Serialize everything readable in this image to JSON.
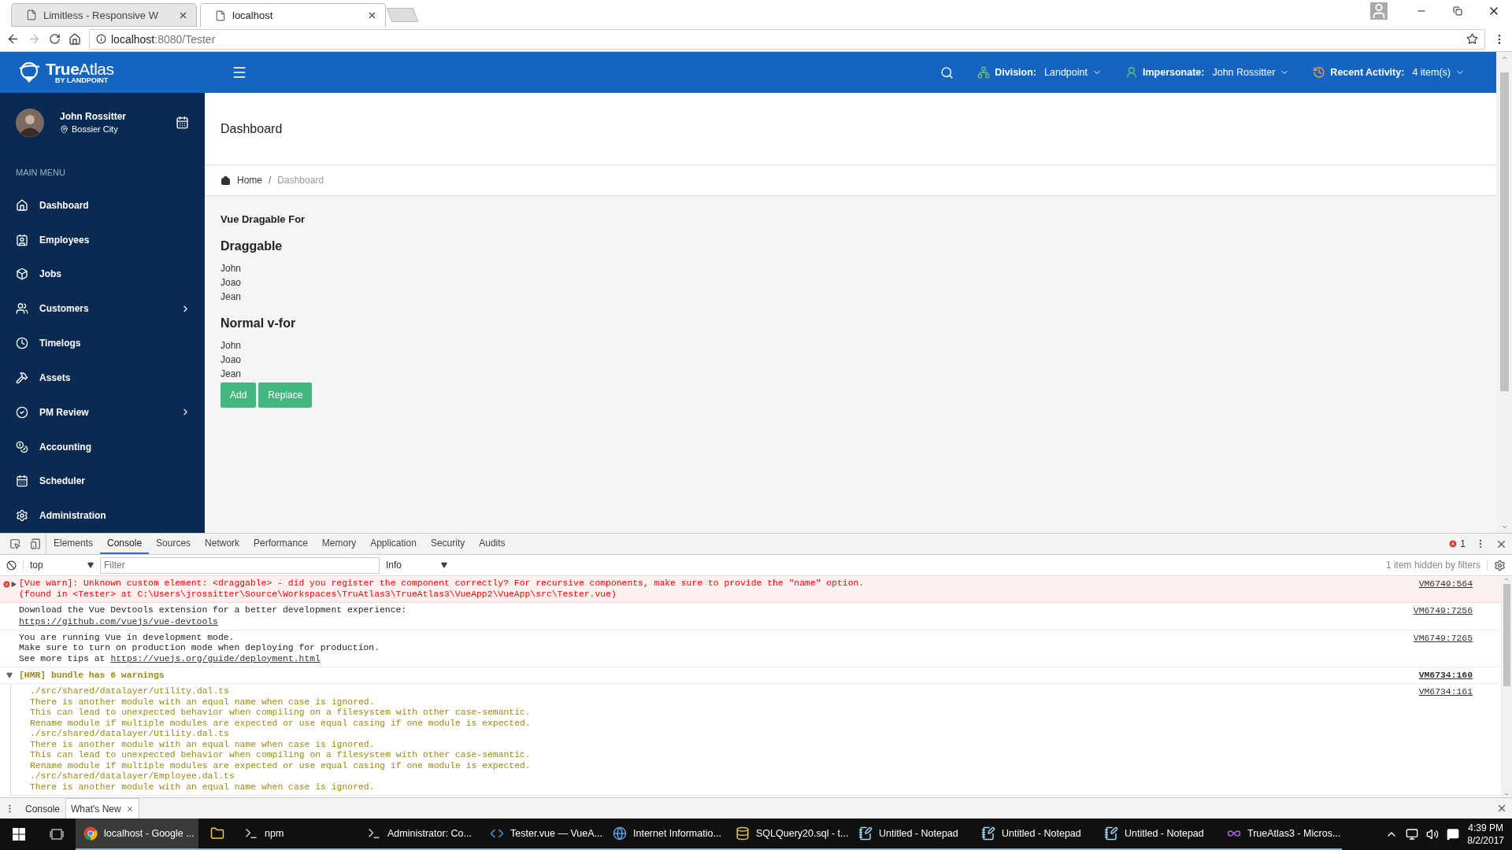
{
  "browser": {
    "tabs": [
      {
        "title": "Limitless - Responsive W",
        "selected": false
      },
      {
        "title": "localhost",
        "selected": true
      }
    ],
    "address": {
      "host": "localhost",
      "path": ":8080/Tester"
    }
  },
  "header": {
    "logo": {
      "name": "**True**Atlas",
      "tagline": "BY LANDPOINT"
    },
    "menus": [
      {
        "label": "Division:",
        "value": "Landpoint",
        "color": "#6cc16f"
      },
      {
        "label": "Impersonate:",
        "value": "John Rossitter",
        "color": "#6cc16f"
      },
      {
        "label": "Recent Activity:",
        "value": "4 item(s)",
        "color": "#f0a04b"
      }
    ]
  },
  "sidebar": {
    "user": {
      "name": "John Rossitter",
      "location": "Bossier City"
    },
    "menu_label": "MAIN MENU",
    "menu": [
      {
        "label": "Dashboard",
        "has_submenu": false
      },
      {
        "label": "Employees",
        "has_submenu": false
      },
      {
        "label": "Jobs",
        "has_submenu": false
      },
      {
        "label": "Customers",
        "has_submenu": true
      },
      {
        "label": "Timelogs",
        "has_submenu": false
      },
      {
        "label": "Assets",
        "has_submenu": false
      },
      {
        "label": "PM Review",
        "has_submenu": true
      },
      {
        "label": "Accounting",
        "has_submenu": false
      },
      {
        "label": "Scheduler",
        "has_submenu": false
      },
      {
        "label": "Administration",
        "has_submenu": false
      }
    ]
  },
  "content": {
    "title": "Dashboard",
    "breadcrumb": [
      {
        "label": "Home",
        "current": false
      },
      {
        "label": "Dashboard",
        "current": true
      }
    ],
    "breadcrumb_separator": "/",
    "subtitle": "Vue Dragable For",
    "sections": [
      {
        "heading": "Draggable",
        "items": [
          "John",
          "Joao",
          "Jean"
        ]
      },
      {
        "heading": "Normal v-for",
        "items": [
          "John",
          "Joao",
          "Jean"
        ]
      }
    ],
    "buttons": [
      "Add",
      "Replace"
    ]
  },
  "devtools": {
    "tabs": [
      {
        "label": "Elements",
        "selected": false
      },
      {
        "label": "Console",
        "selected": true
      },
      {
        "label": "Sources",
        "selected": false
      },
      {
        "label": "Network",
        "selected": false
      },
      {
        "label": "Performance",
        "selected": false
      },
      {
        "label": "Memory",
        "selected": false
      },
      {
        "label": "Application",
        "selected": false
      },
      {
        "label": "Security",
        "selected": false
      },
      {
        "label": "Audits",
        "selected": false
      }
    ],
    "error_count": "1",
    "context": "top",
    "filter": {
      "placeholder": "Filter"
    },
    "level": "Info",
    "hidden_note": "1 item hidden by filters",
    "messages": [
      {
        "kind": "error",
        "expanded": false,
        "source": "VM6749:564",
        "lines": [
          {
            "text": "[Vue warn]: Unknown custom element: <draggable> - did you register the component correctly? For recursive components, make sure to provide the \"name\" option."
          },
          {
            "text": "(found in <Tester> at C:\\Users\\jrossitter\\Source\\Workspaces\\TruAtlas3\\TrueAtlas3\\VueApp2\\VueApp\\src\\Tester.vue)"
          }
        ]
      },
      {
        "kind": "log",
        "source": "VM6749:7256",
        "lines": [
          {
            "text": "Download the Vue Devtools extension for a better development experience:"
          },
          {
            "link": "https://github.com/vuejs/vue-devtools"
          }
        ]
      },
      {
        "kind": "log",
        "source": "VM6749:7265",
        "lines": [
          {
            "text": "You are running Vue in development mode."
          },
          {
            "text": "Make sure to turn on production mode when deploying for production."
          },
          {
            "text": "See more tips at",
            "link": "https://vuejs.org/guide/deployment.html"
          }
        ]
      },
      {
        "kind": "group",
        "expanded": true,
        "source": "VM6734:160",
        "title": "[HMR] bundle has 6 warnings",
        "children": [
          {
            "kind": "warning",
            "source": "VM6734:161",
            "lines": [
              {
                "text": "./src/shared/datalayer/utility.dal.ts"
              },
              {
                "text": "There is another module with an equal name when case is ignored."
              },
              {
                "text": "This can lead to unexpected behavior when compiling on a filesystem with other case-semantic."
              },
              {
                "text": "Rename module if multiple modules are expected or use equal casing if one module is expected."
              },
              {
                "text": "./src/shared/datalayer/Utility.dal.ts"
              },
              {
                "text": "There is another module with an equal name when case is ignored."
              },
              {
                "text": "This can lead to unexpected behavior when compiling on a filesystem with other case-semantic."
              },
              {
                "text": "Rename module if multiple modules are expected or use equal casing if one module is expected."
              },
              {
                "text": "./src/shared/datalayer/Employee.dal.ts"
              },
              {
                "text": "There is another module with an equal name when case is ignored."
              }
            ]
          }
        ]
      }
    ],
    "drawer_tabs": [
      {
        "label": "Console",
        "selected": false,
        "closable": false
      },
      {
        "label": "What's New",
        "selected": true,
        "closable": true
      }
    ]
  },
  "taskbar": {
    "apps": [
      {
        "kind": "chrome",
        "label": "localhost - Google ...",
        "selected": true
      },
      {
        "kind": "explorer",
        "selected": false
      },
      {
        "kind": "terminal",
        "label": "npm",
        "selected": false
      },
      {
        "kind": "terminal",
        "label": "Administrator: Co...",
        "selected": false
      },
      {
        "kind": "vscode",
        "label": "Tester.vue — VueA...",
        "selected": false
      },
      {
        "kind": "iis",
        "label": "Internet Informatio...",
        "selected": false
      },
      {
        "kind": "sql",
        "label": "SQLQuery20.sql - t...",
        "selected": false
      },
      {
        "kind": "notepad",
        "label": "Untitled - Notepad",
        "selected": false
      },
      {
        "kind": "notepad",
        "label": "Untitled - Notepad",
        "selected": false
      },
      {
        "kind": "notepad",
        "label": "Untitled - Notepad",
        "selected": false
      },
      {
        "kind": "vs",
        "label": "TrueAtlas3 - Micros...",
        "selected": false
      }
    ],
    "clock": {
      "time": "4:39 PM",
      "date": "8/2/2017"
    }
  }
}
